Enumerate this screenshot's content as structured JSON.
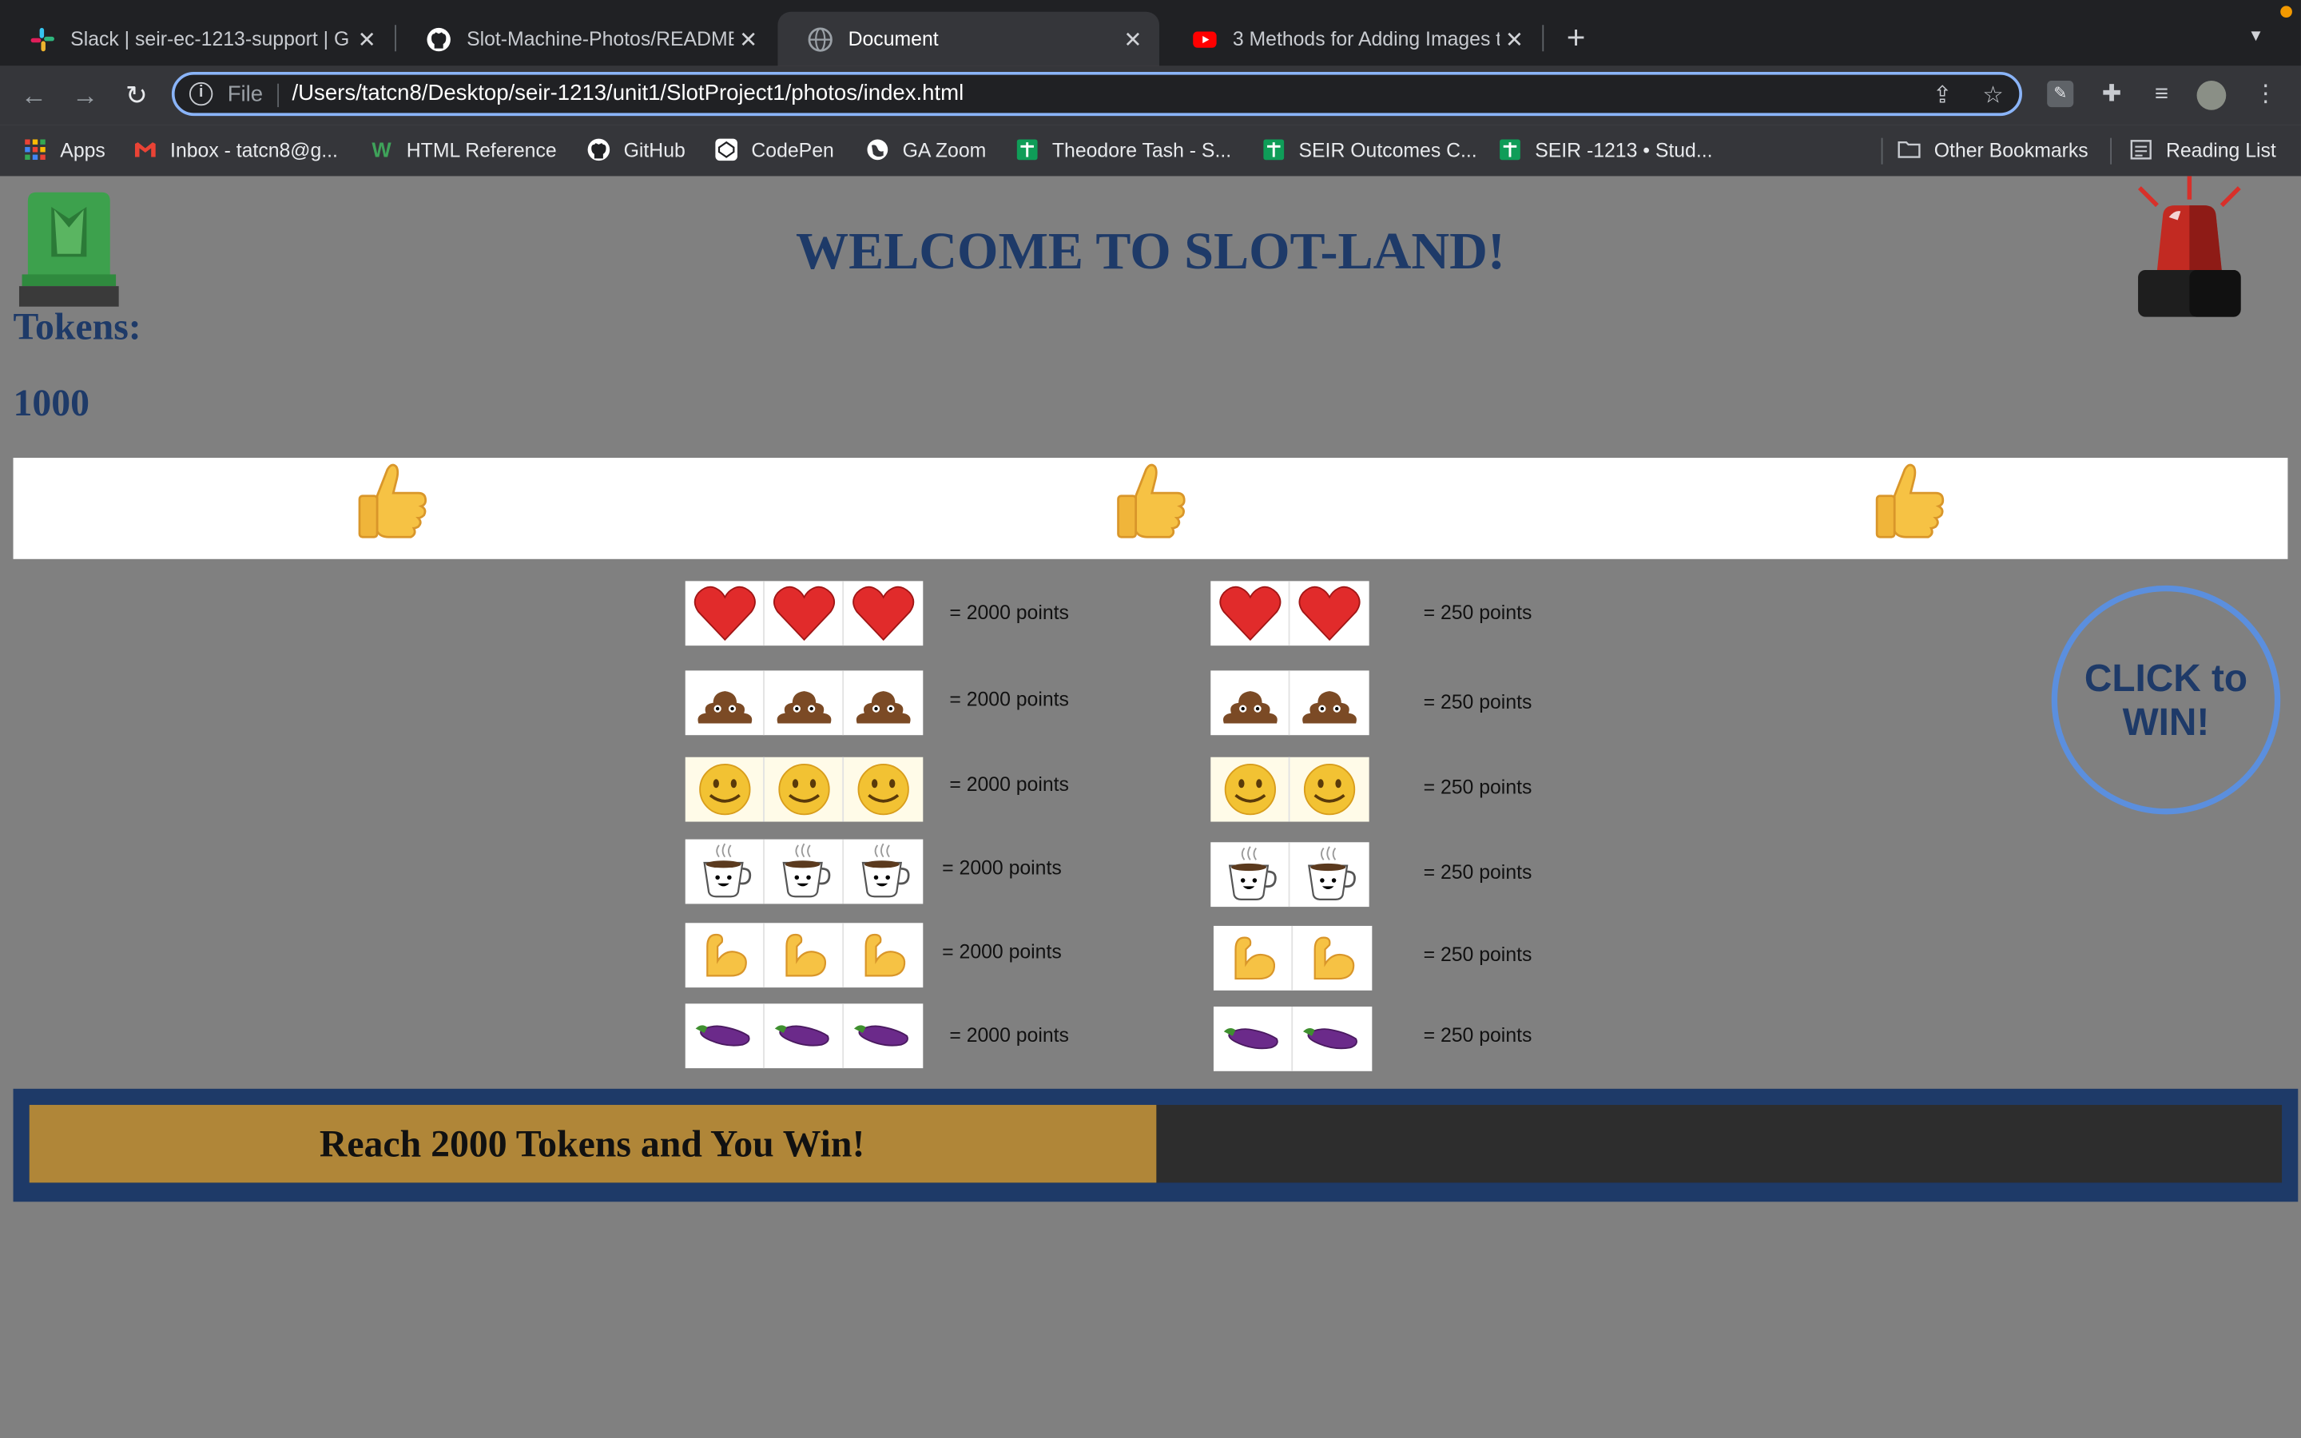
{
  "browser": {
    "tabs": [
      {
        "title": "Slack | seir-ec-1213-support | G",
        "icon": "slack-icon",
        "active": false
      },
      {
        "title": "Slot-Machine-Photos/README",
        "icon": "github-icon",
        "active": false
      },
      {
        "title": "Document",
        "icon": "globe-icon",
        "active": true
      },
      {
        "title": "3 Methods for Adding Images t",
        "icon": "youtube-icon",
        "active": false
      }
    ],
    "address": {
      "scheme": "File",
      "url": "/Users/tatcn8/Desktop/seir-1213/unit1/SlotProject1/photos/index.html"
    },
    "bookmarks": [
      {
        "label": "Apps",
        "icon": "apps-grid-icon"
      },
      {
        "label": "Inbox - tatcn8@g...",
        "icon": "gmail-icon"
      },
      {
        "label": "HTML Reference",
        "icon": "w3-icon"
      },
      {
        "label": "GitHub",
        "icon": "github-icon"
      },
      {
        "label": "CodePen",
        "icon": "codepen-icon"
      },
      {
        "label": "GA Zoom",
        "icon": "globe-icon"
      },
      {
        "label": "Theodore Tash - S...",
        "icon": "sheets-icon"
      },
      {
        "label": "SEIR Outcomes C...",
        "icon": "sheets-icon"
      },
      {
        "label": "SEIR -1213 • Stud...",
        "icon": "sheets-icon"
      }
    ],
    "other_bookmarks": "Other Bookmarks",
    "reading_list": "Reading List"
  },
  "page": {
    "title": "WELCOME TO SLOT-LAND!",
    "tokens_label": "Tokens:",
    "tokens_value": "1000",
    "reels": [
      "thumbs-up",
      "thumbs-up",
      "thumbs-up"
    ],
    "paytable": [
      {
        "symbol": "heart",
        "triple": "= 2000 points",
        "double": "= 250 points"
      },
      {
        "symbol": "poop",
        "triple": "= 2000 points",
        "double": "= 250 points"
      },
      {
        "symbol": "smiley",
        "triple": "= 2000 points",
        "double": "= 250 points"
      },
      {
        "symbol": "coffee",
        "triple": "= 2000 points",
        "double": "= 250 points"
      },
      {
        "symbol": "flexed-bicep",
        "triple": "= 2000 points",
        "double": "= 250 points"
      },
      {
        "symbol": "eggplant",
        "triple": "= 2000 points",
        "double": "= 250 points"
      }
    ],
    "win_button": "CLICK to WIN!",
    "goal_text": "Reach 2000 Tokens and You Win!",
    "goal_progress": 0.5,
    "colors": {
      "title": "#1e3a68",
      "background": "#808080",
      "goal_fill": "#b08638",
      "goal_track": "#2d2d2d",
      "win_ring": "#5b8fde"
    }
  }
}
